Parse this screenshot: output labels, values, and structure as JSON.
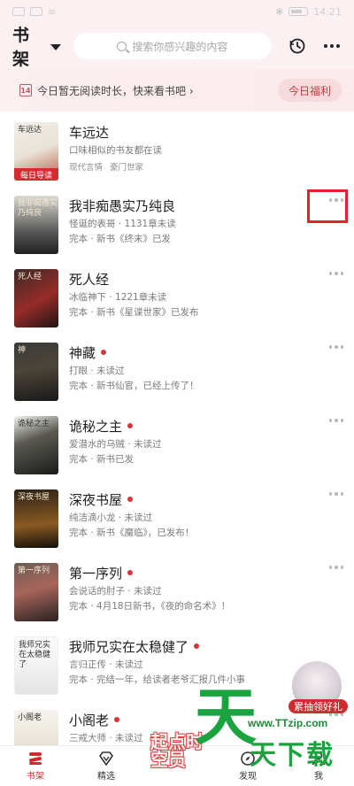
{
  "status_bar": {
    "time": "14:21"
  },
  "header": {
    "title": "书架",
    "search_placeholder": "搜索你感兴趣的内容"
  },
  "banner": {
    "calendar_day": "14",
    "text": "今日暂无阅读时长，快来看书吧",
    "chevron": "›",
    "welfare_label": "今日福利"
  },
  "books": [
    {
      "title": "车远达",
      "line1": "口味相似的书友都在读",
      "genres": [
        "现代言情",
        "豪门世家"
      ],
      "tag": "每日导读",
      "cover_text": "车远达"
    },
    {
      "title": "我非痴愚实乃纯良",
      "line1": "怪诞的表哥 · 1131章未读",
      "line2": "完本 · 新书《终末》已发",
      "unread_dot": false,
      "cover_text": "我非痴愚实乃纯良"
    },
    {
      "title": "死人经",
      "line1": "冰临神下 · 1221章未读",
      "line2": "完本 · 新书《星谍世家》已发布",
      "unread_dot": false,
      "cover_text": "死人经"
    },
    {
      "title": "神藏",
      "line1": "打眼 · 未读过",
      "line2": "完本 · 新书仙官，已经上传了！",
      "unread_dot": true,
      "cover_text": "神"
    },
    {
      "title": "诡秘之主",
      "line1": "爱潜水的乌贼 · 未读过",
      "line2": "完本 · 新书已发",
      "unread_dot": true,
      "cover_text": "诡秘之主"
    },
    {
      "title": "深夜书屋",
      "line1": "纯洁滴小龙 · 未读过",
      "line2": "完本 · 新书《魔临》，已发布！",
      "unread_dot": true,
      "cover_text": "深夜书屋"
    },
    {
      "title": "第一序列",
      "line1": "会说话的肘子 · 未读过",
      "line2": "完本 · 4月18日新书，《夜的命名术》！",
      "unread_dot": true,
      "cover_text": "第一序列"
    },
    {
      "title": "我师兄实在太稳健了",
      "line1": "言归正传 · 未读过",
      "line2": "完本 · 完结一年，给读者老爷汇报几件小事",
      "unread_dot": true,
      "cover_text": "我师兄实在太稳健了"
    },
    {
      "title": "小阁老",
      "line1": "三戒大师 · 未读过",
      "line2": "",
      "unread_dot": true,
      "cover_text": "小阁老"
    }
  ],
  "floating": {
    "label": "累抽领好礼",
    "promo": "起点时空员"
  },
  "watermark": {
    "big": "天",
    "url": "www.TTzip.com",
    "small": "天下载"
  },
  "tabs": [
    {
      "label": "书架",
      "icon": "bookshelf-icon",
      "active": true
    },
    {
      "label": "精选",
      "icon": "diamond-icon",
      "active": false
    },
    {
      "label": "",
      "icon": "promo-icon",
      "active": false
    },
    {
      "label": "发现",
      "icon": "compass-icon",
      "active": false
    },
    {
      "label": "我",
      "icon": "user-icon",
      "active": false
    }
  ],
  "colors": {
    "accent": "#d0292f",
    "banner_bg": "#fbeff0",
    "unread_dot": "#d8343a"
  }
}
